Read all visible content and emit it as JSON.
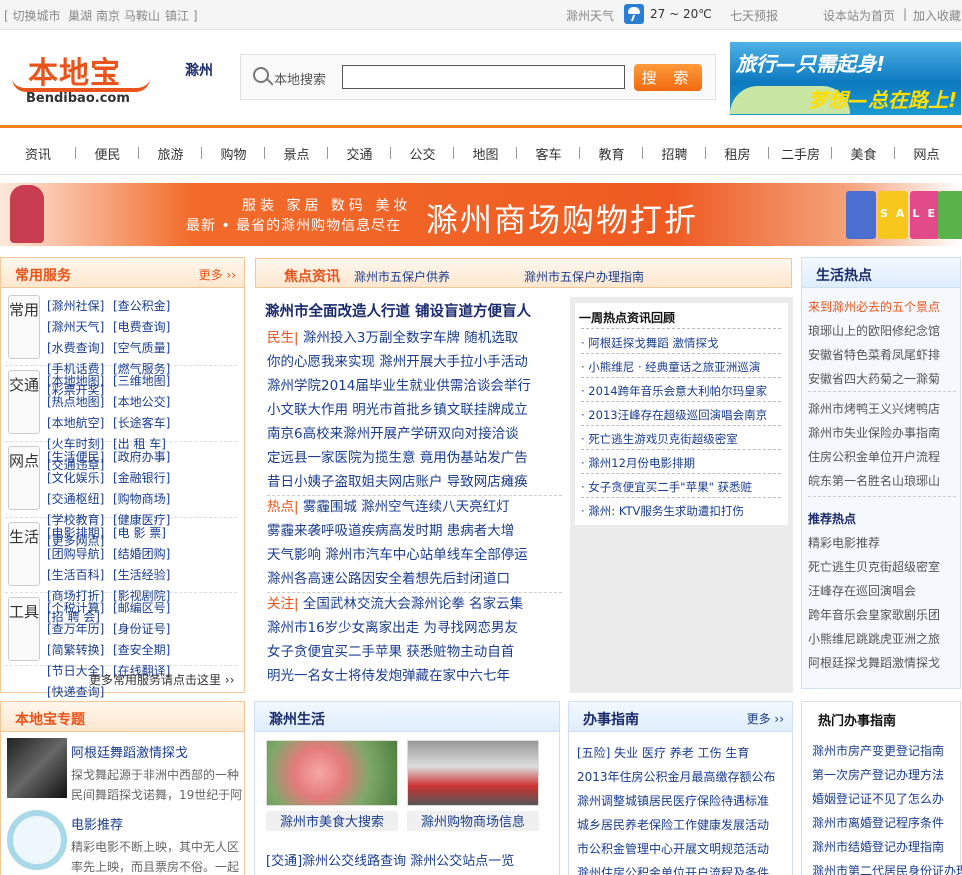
{
  "topbar": {
    "switch_city": "切换城市",
    "cities": [
      "巢湖",
      "南京",
      "马鞍山",
      "镇江"
    ],
    "weather_label": "滁州天气",
    "weather_temp": "27 ~ 20℃",
    "forecast": "七天预报",
    "set_home": "设本站为首页",
    "add_fav": "加入收藏"
  },
  "header": {
    "logo_cn": "本地宝",
    "logo_en": "Bendibao.com",
    "city": "滁州",
    "search_label": "本地搜索",
    "search_value": "",
    "search_button": "搜 索",
    "travel_ad_line1": "旅行—只需起身!",
    "travel_ad_line2": "梦想—总在路上!"
  },
  "nav": [
    "资讯",
    "便民",
    "旅游",
    "购物",
    "景点",
    "交通",
    "公交",
    "地图",
    "客车",
    "教育",
    "招聘",
    "租房",
    "二手房",
    "美食",
    "网点"
  ],
  "banner": {
    "line1": "服装 家居 数码 美妆",
    "line2": "最新 • 最省的滁州购物信息尽在",
    "headline": "滁州商场购物打折",
    "sale": "SALE"
  },
  "services": {
    "title": "常用服务",
    "more": "更多",
    "groups": [
      {
        "tag": "常用",
        "links": [
          "[滁州社保]",
          "[查公积金]",
          "[滁州天气]",
          "[电费查询]",
          "[水费查询]",
          "[空气质量]",
          "[手机话费]",
          "[燃气服务]",
          "[彩票开奖]"
        ]
      },
      {
        "tag": "交通",
        "links": [
          "[本地地图]",
          "[三维地图]",
          "[热点地图]",
          "[本地公交]",
          "[本地航空]",
          "[长途客车]",
          "[火车时刻]",
          "[出 租 车]",
          "[交通违章]"
        ]
      },
      {
        "tag": "网点",
        "links": [
          "[生活便民]",
          "[政府办事]",
          "[文化娱乐]",
          "[金融银行]",
          "[交通枢纽]",
          "[购物商场]",
          "[学校教育]",
          "[健康医疗]",
          "[更多网点]"
        ]
      },
      {
        "tag": "生活",
        "links": [
          "[电影排期]",
          "[电 影 票]",
          "[团购导航]",
          "[结婚团购]",
          "[生活百科]",
          "[生活经验]",
          "[商场打折]",
          "[影视剧院]",
          "[招 聘 会]"
        ]
      },
      {
        "tag": "工具",
        "links": [
          "[个税计算]",
          "[邮编区号]",
          "[查万年历]",
          "[身份证号]",
          "[简繁转换]",
          "[查安全期]",
          "[节日大全]",
          "[在线翻译]",
          "[快递查询]"
        ]
      }
    ],
    "footer": "更多常用服务请点击这里"
  },
  "news": {
    "title": "焦点资讯",
    "tab1": "滁州市五保户供养",
    "tab2": "滁州市五保户办理指南",
    "headline": "滁州市全面改造人行道 铺设盲道方便盲人",
    "lines": [
      {
        "cat": "民生|",
        "text": " 滁州投入3万副全数字车牌  随机选取"
      },
      {
        "cat": "",
        "text": "你的心愿我来实现  滁州开展大手拉小手活动"
      },
      {
        "cat": "",
        "text": "滁州学院2014届毕业生就业供需洽谈会举行"
      },
      {
        "cat": "",
        "text": "小文联大作用  明光市首批乡镇文联挂牌成立"
      },
      {
        "cat": "",
        "text": "南京6高校来滁州开展产学研双向对接洽谈"
      },
      {
        "cat": "",
        "text": "定远县一家医院为揽生意  竟用伪基站发广告"
      },
      {
        "cat": "",
        "text": "昔日小姨子盗取姐夫网店账户  导致网店瘫痪"
      },
      {
        "cat": "热点|",
        "text": " 雾霾围城  滁州空气连续八天亮红灯"
      },
      {
        "cat": "",
        "text": "雾霾来袭呼吸道疾病高发时期  患病者大增"
      },
      {
        "cat": "",
        "text": "天气影响  滁州市汽车中心站单线车全部停运"
      },
      {
        "cat": "",
        "text": "滁州各高速公路因安全着想先后封闭道口"
      },
      {
        "cat": "关注|",
        "text": " 全国武林交流大会滁州论拳  名家云集"
      },
      {
        "cat": "",
        "text": "滁州市16岁少女离家出走  为寻找网恋男友"
      },
      {
        "cat": "",
        "text": "女子贪便宜买二手苹果  获悉赃物主动自首"
      },
      {
        "cat": "",
        "text": "明光一名女士将侍发炮弹藏在家中六七年"
      }
    ],
    "hot_title": "一周热点资讯回顾",
    "hot_items": [
      "· 阿根廷探戈舞蹈  激情探戈",
      "· 小熊维尼 · 经典童话之旅亚洲巡演",
      "· 2014跨年音乐会意大利帕尔玛皇家",
      "· 2013汪峰存在超级巡回演唱会南京",
      "· 死亡逃生游戏贝克街超级密室",
      "· 滁州12月份电影排期",
      "· 女子贪便宜买二手\"苹果\"  获悉赃",
      "· 滁州: KTV服务生求助遭扣打伤"
    ]
  },
  "life_hot": {
    "title": "生活热点",
    "lines": [
      "来到滁州必去的五个景点",
      "琅琊山上的欧阳修纪念馆",
      "安徽省特色菜肴凤尾虾排",
      "安徽省四大药菊之一滁菊",
      "滁州市烤鸭王义兴烤鸭店",
      "滁州市失业保险办事指南",
      "住房公积金单位开户流程",
      "皖东第一名胜名山琅琊山"
    ],
    "rec_title": "推荐热点",
    "rec_lines": [
      "精彩电影推荐",
      "死亡逃生贝克街超级密室",
      "汪峰存在巡回演唱会",
      "跨年音乐会皇家歌剧乐团",
      "小熊维尼跳跳虎亚洲之旅",
      "阿根廷探戈舞蹈激情探戈"
    ]
  },
  "topics": {
    "title": "本地宝专题",
    "items": [
      {
        "title": "阿根廷舞蹈激情探戈",
        "desc1": "探戈舞起源于非洲中西部的一种",
        "desc2": "民间舞蹈探戈诺舞，19世纪于阿"
      },
      {
        "title": "电影推荐",
        "desc1": "精彩电影不断上映，其中无人区",
        "desc2": "率先上映，而且票房不俗。一起"
      }
    ]
  },
  "life": {
    "title": "滁州生活",
    "cap1": "滁州市美食大搜索",
    "cap2": "滁州购物商场信息",
    "line": "[交通]滁州公交线路查询  滁州公交站点一览"
  },
  "guide": {
    "title": "办事指南",
    "more": "更多",
    "cats": "[五险]  失业  医疗  养老  工伤  生育",
    "lines": [
      "2013年住房公积金月最高缴存额公布",
      "滁州调整城镇居民医疗保险待遇标准",
      "城乡居民养老保险工作健康发展活动",
      "市公积金管理中心开展文明规范活动",
      "滁州住房公积金单位开户流程及条件"
    ]
  },
  "hot_guide": {
    "title": "热门办事指南",
    "lines": [
      "滁州市房产变更登记指南",
      "第一次房产登记办理方法",
      "婚姻登记证不见了怎么办",
      "滁州市离婚登记程序条件",
      "滁州市结婚登记办理指南",
      "滁州市第二代居民身份证办理"
    ]
  },
  "colors": {
    "accent": "#f3831f",
    "brand": "#e8541b",
    "link": "#1a3d8f"
  }
}
